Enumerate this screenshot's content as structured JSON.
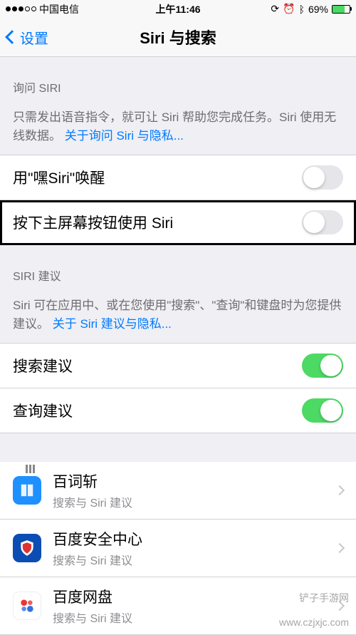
{
  "status": {
    "carrier": "中国电信",
    "time": "上午11:46",
    "battery_pct": "69%"
  },
  "nav": {
    "back": "设置",
    "title": "Siri 与搜索"
  },
  "ask_siri": {
    "header": "询问 SIRI",
    "desc_a": "只需发出语音指令，就可让 Siri 帮助您完成任务。Siri 使用无线数据。",
    "link": "关于询问 Siri 与隐私...",
    "row_hey_siri": "用\"嘿Siri\"唤醒",
    "row_home_btn": "按下主屏幕按钮使用 Siri"
  },
  "suggestions": {
    "header": "SIRI 建议",
    "desc_a": "Siri 可在应用中、或在您使用\"搜索\"、\"查询\"和键盘时为您提供建议。",
    "link": "关于 Siri 建议与隐私...",
    "row_search": "搜索建议",
    "row_lookup": "查询建议"
  },
  "apps": {
    "subtitle": "搜索与 Siri 建议",
    "items": [
      {
        "name": "百词斩"
      },
      {
        "name": "百度安全中心"
      },
      {
        "name": "百度网盘"
      }
    ]
  },
  "watermarks": {
    "w1": "铲子手游网",
    "w2": "www.czjxjc.com"
  }
}
